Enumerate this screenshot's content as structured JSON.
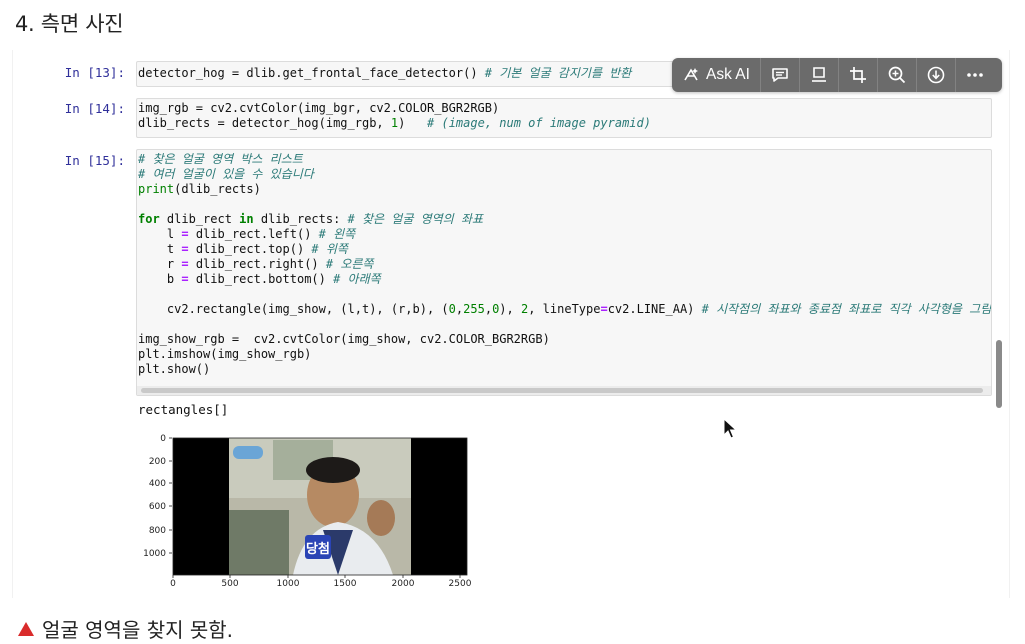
{
  "heading": "4. 측면 사진",
  "cells": [
    {
      "prompt": "In [13]:",
      "lines": [
        [
          [
            "t",
            "detector_hog = dlib.get_frontal_face_detector() "
          ],
          [
            "cm",
            "# 기본 얼굴 감지기를 반환"
          ]
        ]
      ]
    },
    {
      "prompt": "In [14]:",
      "lines": [
        [
          [
            "t",
            "img_rgb = cv2.cvtColor(img_bgr, cv2.COLOR_BGR2RGB)"
          ]
        ],
        [
          [
            "t",
            "dlib_rects = detector_hog(img_rgb, "
          ],
          [
            "num",
            "1"
          ],
          [
            "t",
            ")   "
          ],
          [
            "cm",
            "# (image, num of image pyramid)"
          ]
        ]
      ]
    },
    {
      "prompt": "In [15]:",
      "lines": [
        [
          [
            "cm",
            "# 찾은 얼굴 영역 박스 리스트"
          ]
        ],
        [
          [
            "cm",
            "# 여러 얼굴이 있을 수 있습니다"
          ]
        ],
        [
          [
            "fn",
            "print"
          ],
          [
            "t",
            "(dlib_rects)"
          ]
        ],
        [
          [
            "t",
            ""
          ]
        ],
        [
          [
            "kw",
            "for"
          ],
          [
            "t",
            " dlib_rect "
          ],
          [
            "kw",
            "in"
          ],
          [
            "t",
            " dlib_rects: "
          ],
          [
            "cm",
            "# 찾은 얼굴 영역의 좌표"
          ]
        ],
        [
          [
            "t",
            "    l "
          ],
          [
            "op",
            "="
          ],
          [
            "t",
            " dlib_rect.left() "
          ],
          [
            "cm",
            "# 왼쪽"
          ]
        ],
        [
          [
            "t",
            "    t "
          ],
          [
            "op",
            "="
          ],
          [
            "t",
            " dlib_rect.top() "
          ],
          [
            "cm",
            "# 위쪽"
          ]
        ],
        [
          [
            "t",
            "    r "
          ],
          [
            "op",
            "="
          ],
          [
            "t",
            " dlib_rect.right() "
          ],
          [
            "cm",
            "# 오른쪽"
          ]
        ],
        [
          [
            "t",
            "    b "
          ],
          [
            "op",
            "="
          ],
          [
            "t",
            " dlib_rect.bottom() "
          ],
          [
            "cm",
            "# 아래쪽"
          ]
        ],
        [
          [
            "t",
            ""
          ]
        ],
        [
          [
            "t",
            "    cv2.rectangle(img_show, (l,t), (r,b), ("
          ],
          [
            "num",
            "0"
          ],
          [
            "t",
            ","
          ],
          [
            "num",
            "255"
          ],
          [
            "t",
            ","
          ],
          [
            "num",
            "0"
          ],
          [
            "t",
            "), "
          ],
          [
            "num",
            "2"
          ],
          [
            "t",
            ", lineType"
          ],
          [
            "op",
            "="
          ],
          [
            "t",
            "cv2.LINE_AA) "
          ],
          [
            "cm",
            "# 시작점의 좌표와 종료점 좌표로 직각 사각형을 그림"
          ]
        ],
        [
          [
            "t",
            ""
          ]
        ],
        [
          [
            "t",
            "img_show_rgb =  cv2.cvtColor(img_show, cv2.COLOR_BGR2RGB)"
          ]
        ],
        [
          [
            "t",
            "plt.imshow(img_show_rgb)"
          ]
        ],
        [
          [
            "t",
            "plt.show()"
          ]
        ]
      ]
    }
  ],
  "output_text": "rectangles[]",
  "toolbar": {
    "ask_ai": "Ask AI",
    "icons": [
      "ask-ai-icon",
      "comment-icon",
      "note-icon",
      "crop-icon",
      "zoom-in-icon",
      "download-icon",
      "more-icon"
    ]
  },
  "plot": {
    "y_ticks": [
      "0",
      "200",
      "400",
      "600",
      "800",
      "1000"
    ],
    "x_ticks": [
      "0",
      "500",
      "1000",
      "1500",
      "2000",
      "2500"
    ],
    "badge": "당첨"
  },
  "caption": "얼굴 영역을 찾지 못함.",
  "colors": {
    "prompt": "#30309a",
    "toolbar_bg": "#6b6b6b",
    "caption_triangle": "#d92b2b"
  }
}
